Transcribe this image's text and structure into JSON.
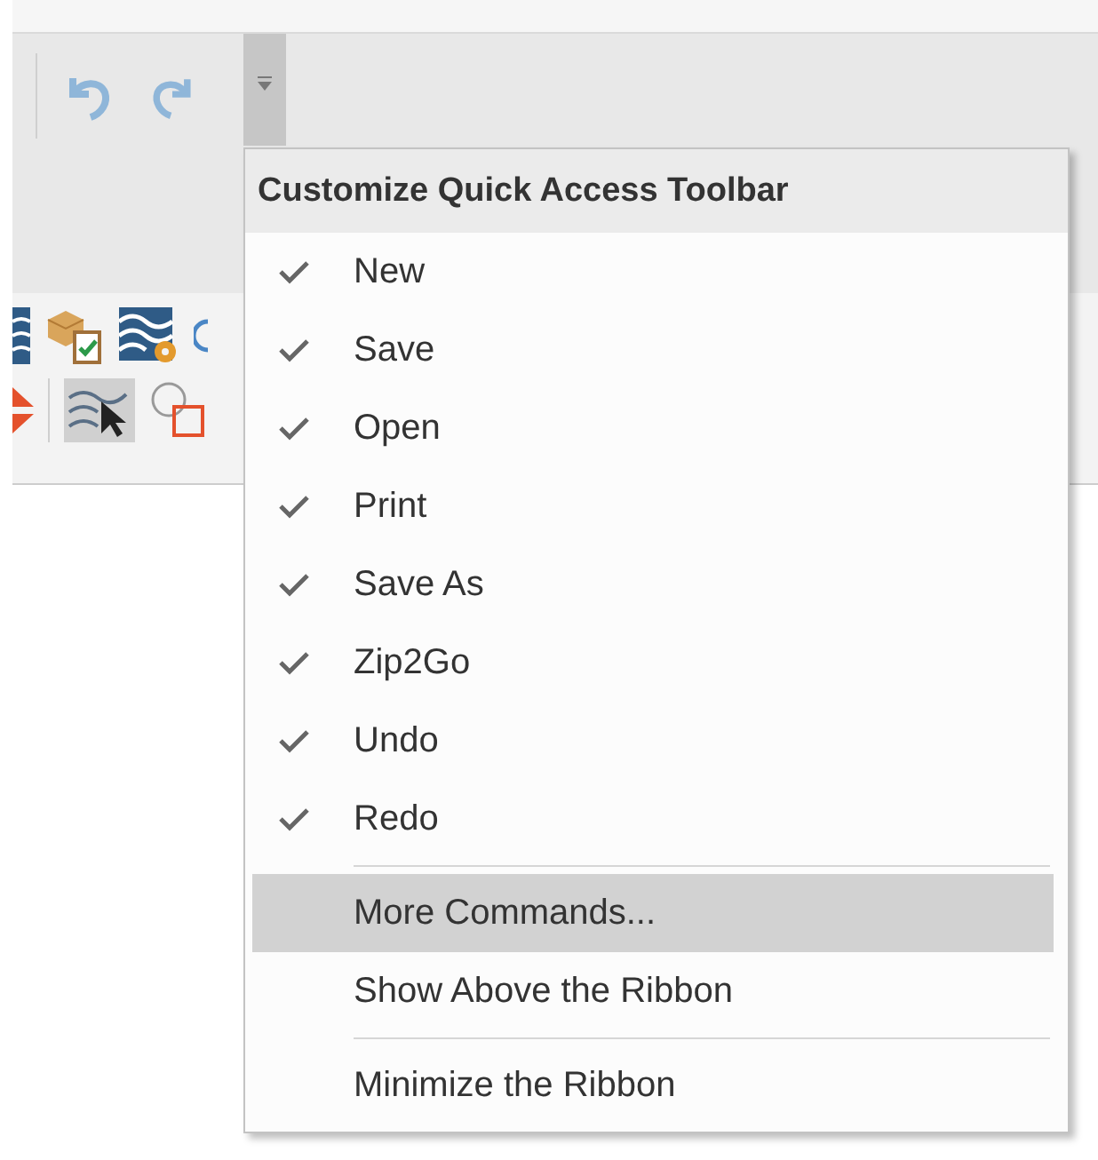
{
  "menu": {
    "title": "Customize Quick Access Toolbar",
    "items": [
      {
        "kind": "check",
        "label": "New",
        "checked": true,
        "selected": false
      },
      {
        "kind": "check",
        "label": "Save",
        "checked": true,
        "selected": false
      },
      {
        "kind": "check",
        "label": "Open",
        "checked": true,
        "selected": false
      },
      {
        "kind": "check",
        "label": "Print",
        "checked": true,
        "selected": false
      },
      {
        "kind": "check",
        "label": "Save As",
        "checked": true,
        "selected": false
      },
      {
        "kind": "check",
        "label": "Zip2Go",
        "checked": true,
        "selected": false
      },
      {
        "kind": "check",
        "label": "Undo",
        "checked": true,
        "selected": false
      },
      {
        "kind": "check",
        "label": "Redo",
        "checked": true,
        "selected": false
      },
      {
        "kind": "separator"
      },
      {
        "kind": "command",
        "label": "More Commands...",
        "selected": true
      },
      {
        "kind": "command",
        "label": "Show Above the Ribbon",
        "selected": false
      },
      {
        "kind": "separator"
      },
      {
        "kind": "command",
        "label": "Minimize the Ribbon",
        "selected": false
      }
    ]
  }
}
